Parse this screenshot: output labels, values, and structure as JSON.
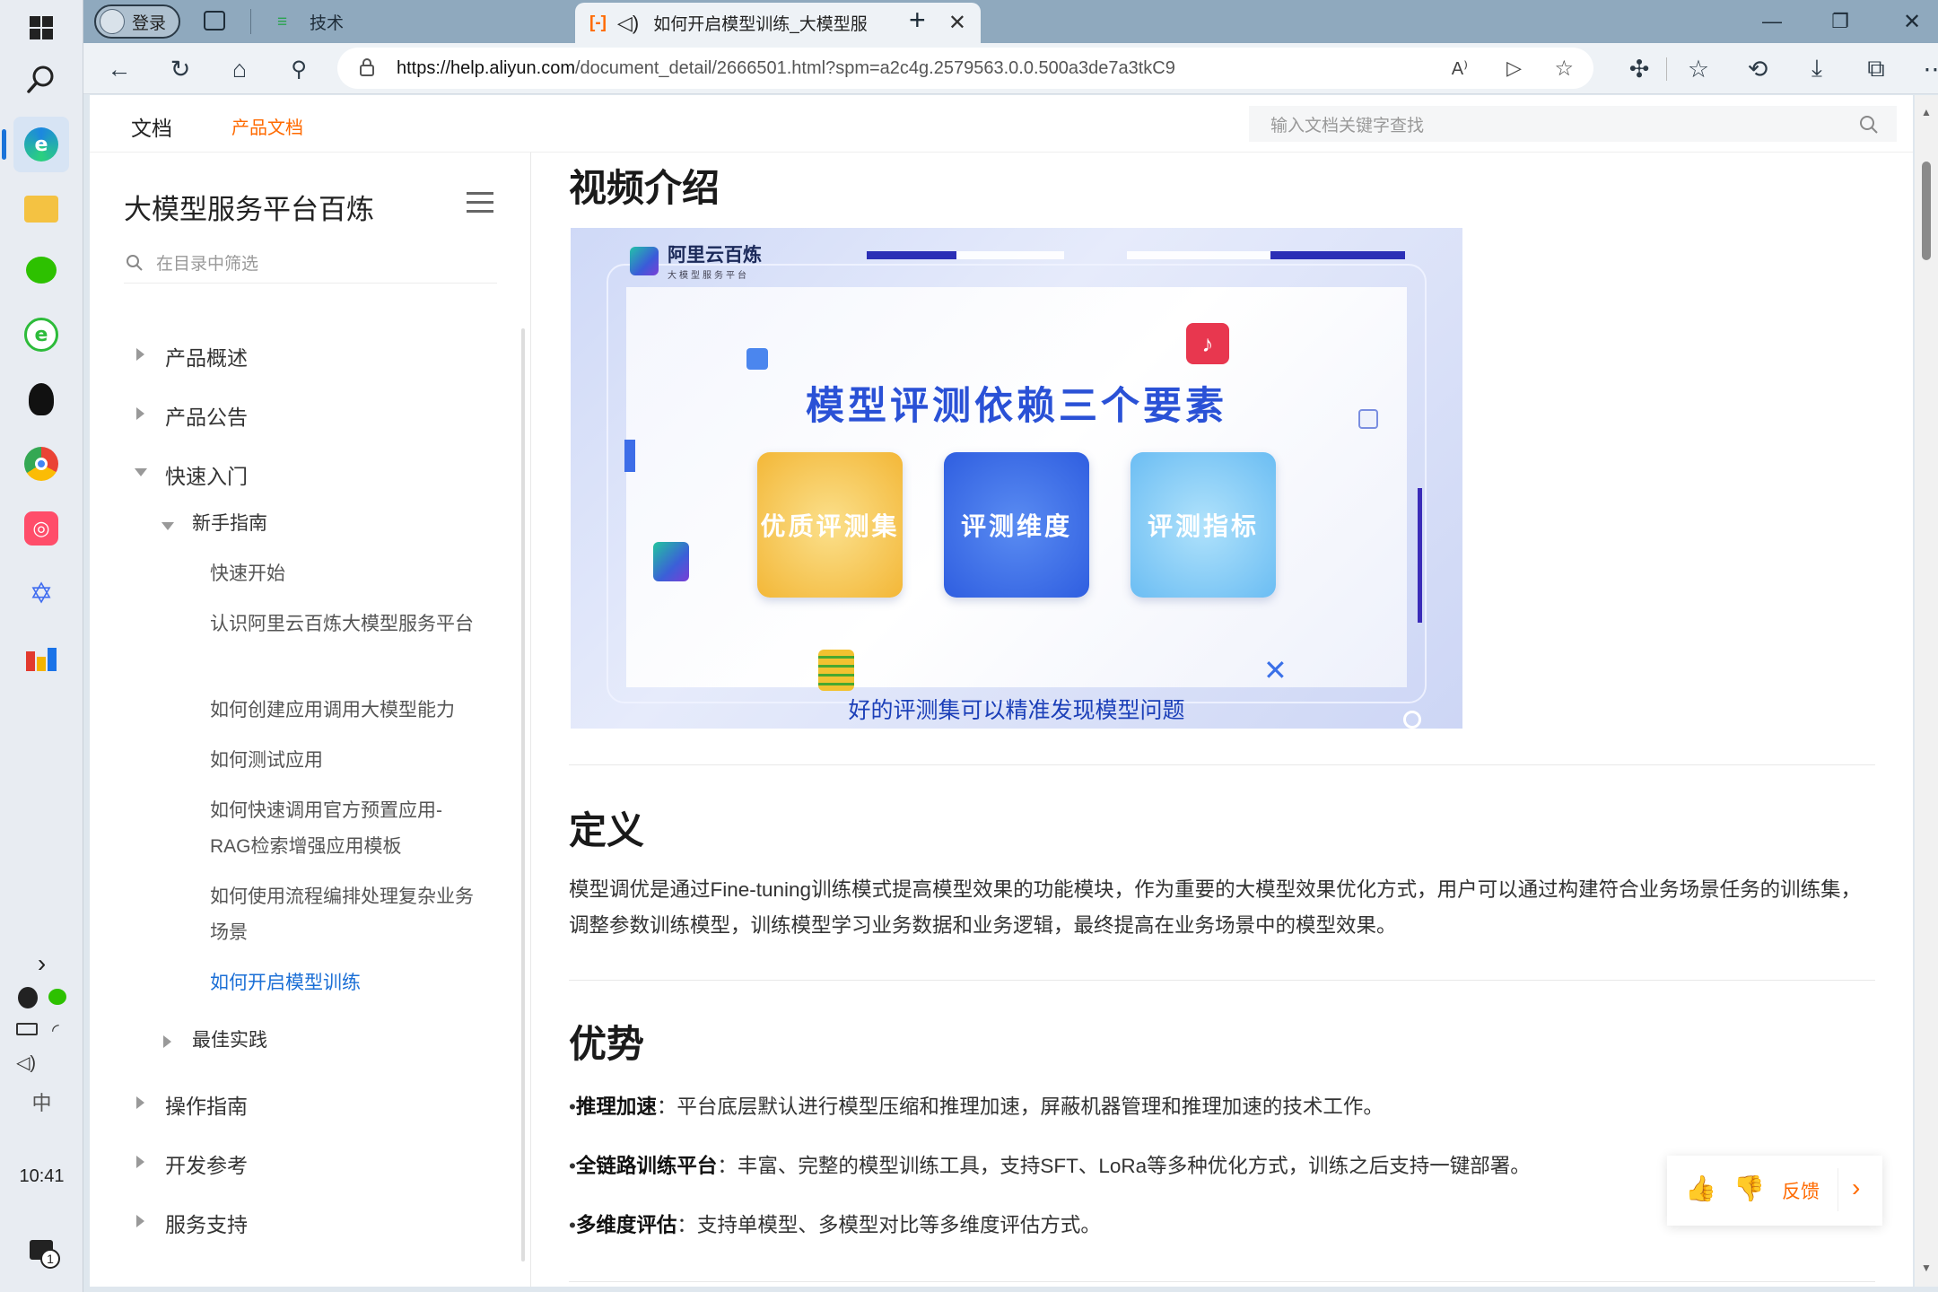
{
  "taskbar": {
    "clock": "10:41",
    "ime": "中",
    "notify_count": "1",
    "expand_glyph": "›"
  },
  "browser": {
    "profile_label": "登录",
    "tabs": [
      {
        "label": "技术",
        "state": "inactive"
      },
      {
        "label": "如何开启模型训练_大模型服",
        "state": "current"
      }
    ],
    "url_host": "https://help.aliyun.com",
    "url_path": "/document_detail/2666501.html?spm=a2c4g.2579563.0.0.500a3de7a3tkC9",
    "read_aloud_label": "A⁾"
  },
  "topnav": {
    "docs": "文档",
    "product_docs": "产品文档",
    "search_placeholder": "输入文档关键字查找"
  },
  "sidebar": {
    "title": "大模型服务平台百炼",
    "filter_placeholder": "在目录中筛选",
    "items": [
      {
        "label": "产品概述"
      },
      {
        "label": "产品公告"
      },
      {
        "label": "快速入门"
      },
      {
        "label": "新手指南"
      },
      {
        "label": "快速开始"
      },
      {
        "label": "认识阿里云百炼大模型服务平台"
      },
      {
        "label": "如何创建应用调用大模型能力"
      },
      {
        "label": "如何测试应用"
      },
      {
        "label": "如何快速调用官方预置应用-RAG检索增强应用模板"
      },
      {
        "label": "如何使用流程编排处理复杂业务场景"
      },
      {
        "label": "如何开启模型训练"
      },
      {
        "label": "最佳实践"
      },
      {
        "label": "操作指南"
      },
      {
        "label": "开发参考"
      },
      {
        "label": "服务支持"
      }
    ]
  },
  "content": {
    "video_heading": "视频介绍",
    "video": {
      "logo_name": "阿里云百炼",
      "logo_sub": "大模型服务平台",
      "title": "模型评测依赖三个要素",
      "cards": [
        "优质评测集",
        "评测维度",
        "评测指标"
      ],
      "subtitle": "好的评测集可以精准发现模型问题",
      "card_colors": [
        "#f6c455",
        "#3b6ee6",
        "#7ec8f6"
      ]
    },
    "definition_heading": "定义",
    "definition_text": "模型调优是通过Fine-tuning训练模式提高模型效果的功能模块，作为重要的大模型效果优化方式，用户可以通过构建符合业务场景任务的训练集，调整参数训练模型，训练模型学习业务数据和业务逻辑，最终提高在业务场景中的模型效果。",
    "advantage_heading": "优势",
    "advantages": [
      {
        "title": "推理加速",
        "text": "：平台底层默认进行模型压缩和推理加速，屏蔽机器管理和推理加速的技术工作。"
      },
      {
        "title": "全链路训练平台",
        "text": "：丰富、完整的模型训练工具，支持SFT、LoRa等多种优化方式，训练之后支持一键部署。"
      },
      {
        "title": "多维度评估",
        "text": "：支持单模型、多模型对比等多维度评估方式。"
      }
    ]
  },
  "feedback": {
    "label": "反馈"
  },
  "colors": {
    "accent_orange": "#ff6a00",
    "link_blue": "#1b6fd6",
    "tab_strip": "#8fa9be"
  }
}
